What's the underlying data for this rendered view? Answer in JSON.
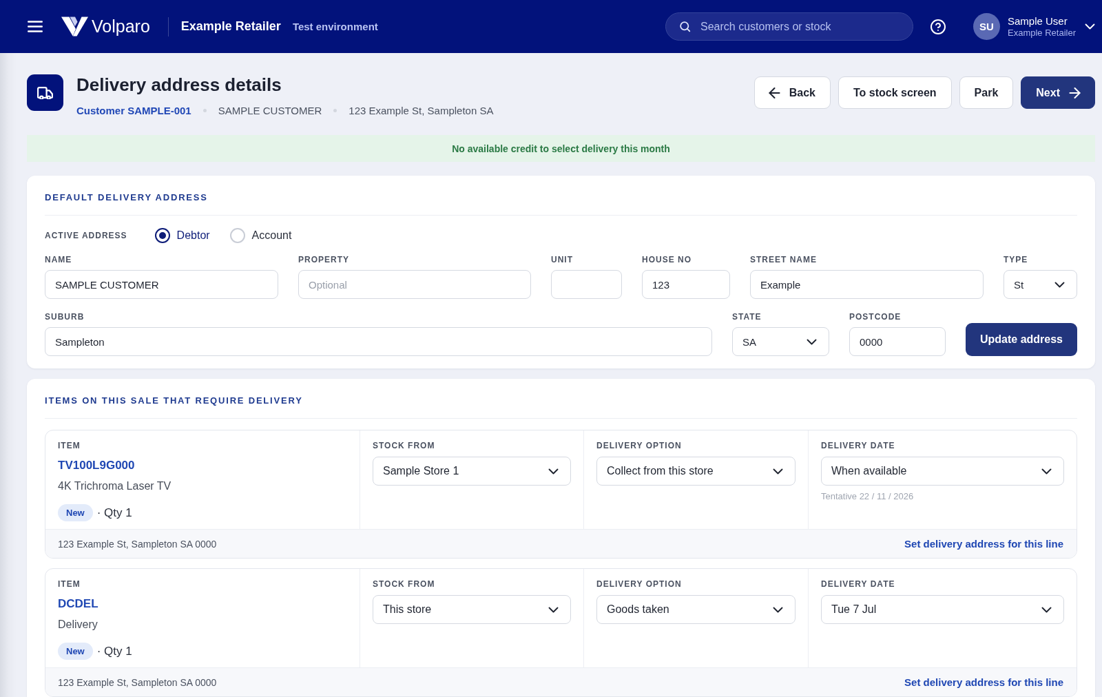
{
  "header": {
    "brand": "Volparo",
    "store": "Example Retailer",
    "environment": "Test environment",
    "search": {
      "placeholder": "Search customers or stock"
    },
    "user": {
      "initials": "SU",
      "name": "Sample User",
      "organization": "Example Retailer"
    }
  },
  "page": {
    "title": "Delivery address details",
    "breadcrumbs": [
      {
        "kind": "link",
        "text": "Customer SAMPLE-001"
      },
      {
        "kind": "text",
        "text": "SAMPLE CUSTOMER"
      },
      {
        "kind": "text",
        "text": "123 Example St, Sampleton SA"
      }
    ],
    "actions": [
      {
        "kind": "back",
        "label": "Back"
      },
      {
        "kind": "outline",
        "label": "To stock screen"
      },
      {
        "kind": "outline",
        "label": "Park"
      },
      {
        "kind": "next",
        "label": "Next"
      }
    ]
  },
  "notice": {
    "text": "No available credit to select delivery this month"
  },
  "default_address": {
    "title": "DEFAULT DELIVERY ADDRESS",
    "active_address": {
      "label": "ACTIVE ADDRESS",
      "options": [
        {
          "label": "Debtor",
          "selected": true
        },
        {
          "label": "Account",
          "selected": false
        }
      ]
    },
    "field_rows": [
      {
        "fields": [
          {
            "kind": "text",
            "label": "NAME",
            "value": "SAMPLE CUSTOMER"
          },
          {
            "kind": "text",
            "label": "PROPERTY",
            "placeholder": "Optional"
          },
          {
            "kind": "text",
            "label": "UNIT"
          },
          {
            "kind": "text",
            "label": "HOUSE NO",
            "value": "123"
          },
          {
            "kind": "text",
            "label": "STREET NAME",
            "value": "Example"
          },
          {
            "kind": "select",
            "label": "TYPE",
            "value": "St"
          }
        ]
      },
      {
        "fields": [
          {
            "kind": "text",
            "label": "SUBURB",
            "value": "Sampleton"
          },
          {
            "kind": "select",
            "label": "STATE",
            "value": "SA"
          },
          {
            "kind": "text",
            "label": "POSTCODE",
            "value": "0000"
          }
        ],
        "button": "Update address"
      }
    ]
  },
  "delivery_items": {
    "title": "ITEMS ON THIS SALE THAT REQUIRE DELIVERY",
    "items": [
      {
        "item_label": "ITEM",
        "code": "TV100L9G000",
        "description": "4K Trichroma Laser TV",
        "badge": "New",
        "quantity": "· Qty 1",
        "selects": [
          {
            "label": "STOCK FROM",
            "value": "Sample Store 1"
          },
          {
            "label": "DELIVERY OPTION",
            "value": "Collect from this store"
          },
          {
            "label": "DELIVERY DATE",
            "value": "When available",
            "note": "Tentative 22 / 11 / 2026"
          }
        ],
        "address": "123 Example St, Sampleton SA 0000",
        "link": "Set delivery address for this line"
      },
      {
        "item_label": "ITEM",
        "code": "DCDEL",
        "description": "Delivery",
        "badge": "New",
        "quantity": "· Qty 1",
        "selects": [
          {
            "label": "STOCK FROM",
            "value": "This store"
          },
          {
            "label": "DELIVERY OPTION",
            "value": "Goods taken"
          },
          {
            "label": "DELIVERY DATE",
            "value": "Tue 7 Jul"
          }
        ],
        "address": "123 Example St, Sampleton SA 0000",
        "link": "Set delivery address for this line"
      }
    ]
  }
}
